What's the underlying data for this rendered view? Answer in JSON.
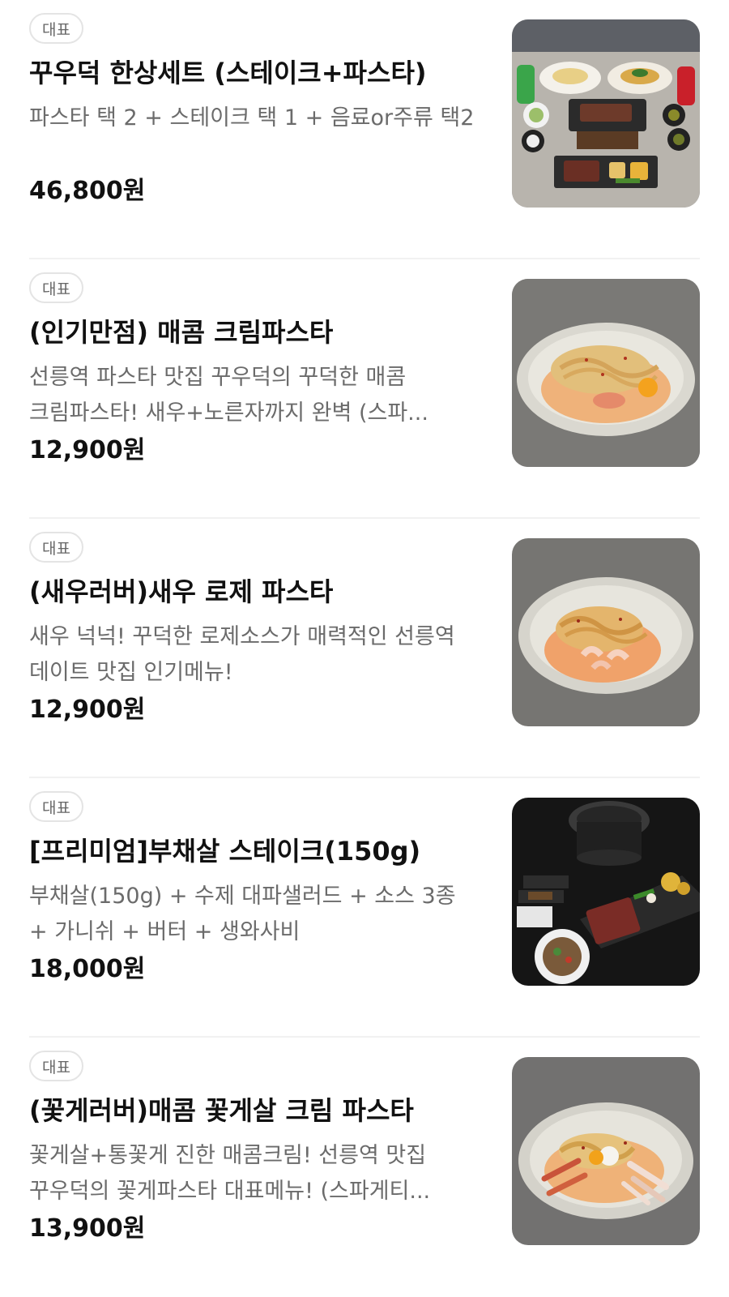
{
  "menu_items": [
    {
      "badge": "대표",
      "name": "꾸우덕 한상세트 (스테이크+파스타)",
      "description": "파스타 택 2 + 스테이크 택 1 + 음료or주류 택2",
      "price": "46,800원",
      "photo": "set-meal-photo"
    },
    {
      "badge": "대표",
      "name": "(인기만점) 매콤 크림파스타",
      "description": "선릉역 파스타 맛집 꾸우덕의 꾸덕한 매콤 크림파스타! 새우+노른자까지 완벽 (스파...",
      "price": "12,900원",
      "photo": "spicy-cream-pasta-photo"
    },
    {
      "badge": "대표",
      "name": "(새우러버)새우 로제 파스타",
      "description": "새우 넉넉! 꾸덕한 로제소스가 매력적인 선릉역 데이트 맛집 인기메뉴!",
      "price": "12,900원",
      "photo": "shrimp-rose-pasta-photo"
    },
    {
      "badge": "대표",
      "name": "[프리미엄]부채살 스테이크(150g)",
      "description": "부채살(150g) + 수제 대파샐러드 + 소스 3종 + 가니쉬 + 버터 + 생와사비",
      "price": "18,000원",
      "photo": "flat-iron-steak-photo"
    },
    {
      "badge": "대표",
      "name": "(꽃게러버)매콤 꽃게살 크림 파스타",
      "description": "꽃게살+통꽃게 진한 매콤크림! 선릉역 맛집 꾸우덕의 꽃게파스타 대표메뉴! (스파게티...",
      "price": "13,900원",
      "photo": "crab-cream-pasta-photo"
    }
  ]
}
